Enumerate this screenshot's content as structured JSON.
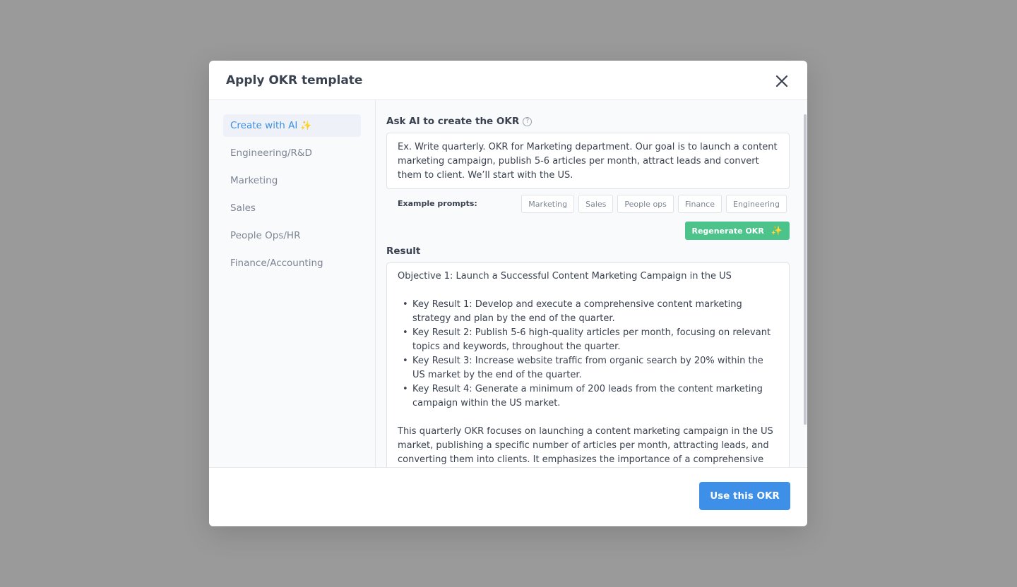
{
  "modal": {
    "title": "Apply OKR template"
  },
  "sidebar": {
    "items": [
      {
        "label": "Create with AI",
        "active": true,
        "icon": "sparkles-icon"
      },
      {
        "label": "Engineering/R&D"
      },
      {
        "label": "Marketing"
      },
      {
        "label": "Sales"
      },
      {
        "label": "People Ops/HR"
      },
      {
        "label": "Finance/Accounting"
      }
    ]
  },
  "ask": {
    "label": "Ask AI to create the OKR",
    "help_icon": "?",
    "prompt_text": "Ex. Write quarterly. OKR for Marketing department. Our goal is to launch a content marketing campaign, publish 5-6 articles per month, attract leads and convert them to client. We’ll start with the US."
  },
  "examples": {
    "label": "Example prompts:",
    "chips": [
      "Marketing",
      "Sales",
      "People ops",
      "Finance",
      "Engineering"
    ]
  },
  "regenerate_label": "Regenerate OKR",
  "result": {
    "label": "Result",
    "objective": "Objective 1: Launch a Successful Content Marketing Campaign in the US",
    "key_results": [
      "Key Result 1: Develop and execute a comprehensive content marketing strategy and plan by the end of the quarter.",
      "Key Result 2: Publish 5-6 high-quality articles per month, focusing on relevant topics and keywords, throughout the quarter.",
      "Key Result 3: Increase website traffic from organic search by 20% within the US market by the end of the quarter.",
      "Key Result 4: Generate a minimum of 200 leads from the content marketing campaign within the US market."
    ],
    "summary": "This quarterly OKR focuses on launching a content marketing campaign in the US market, publishing a specific number of articles per month, attracting leads, and converting them into clients. It emphasizes the importance of a comprehensive"
  },
  "footer": {
    "use_label": "Use this OKR"
  },
  "colors": {
    "primary": "#3d8fe8",
    "success": "#4cc38a",
    "overlay": "#9a9a9a"
  }
}
